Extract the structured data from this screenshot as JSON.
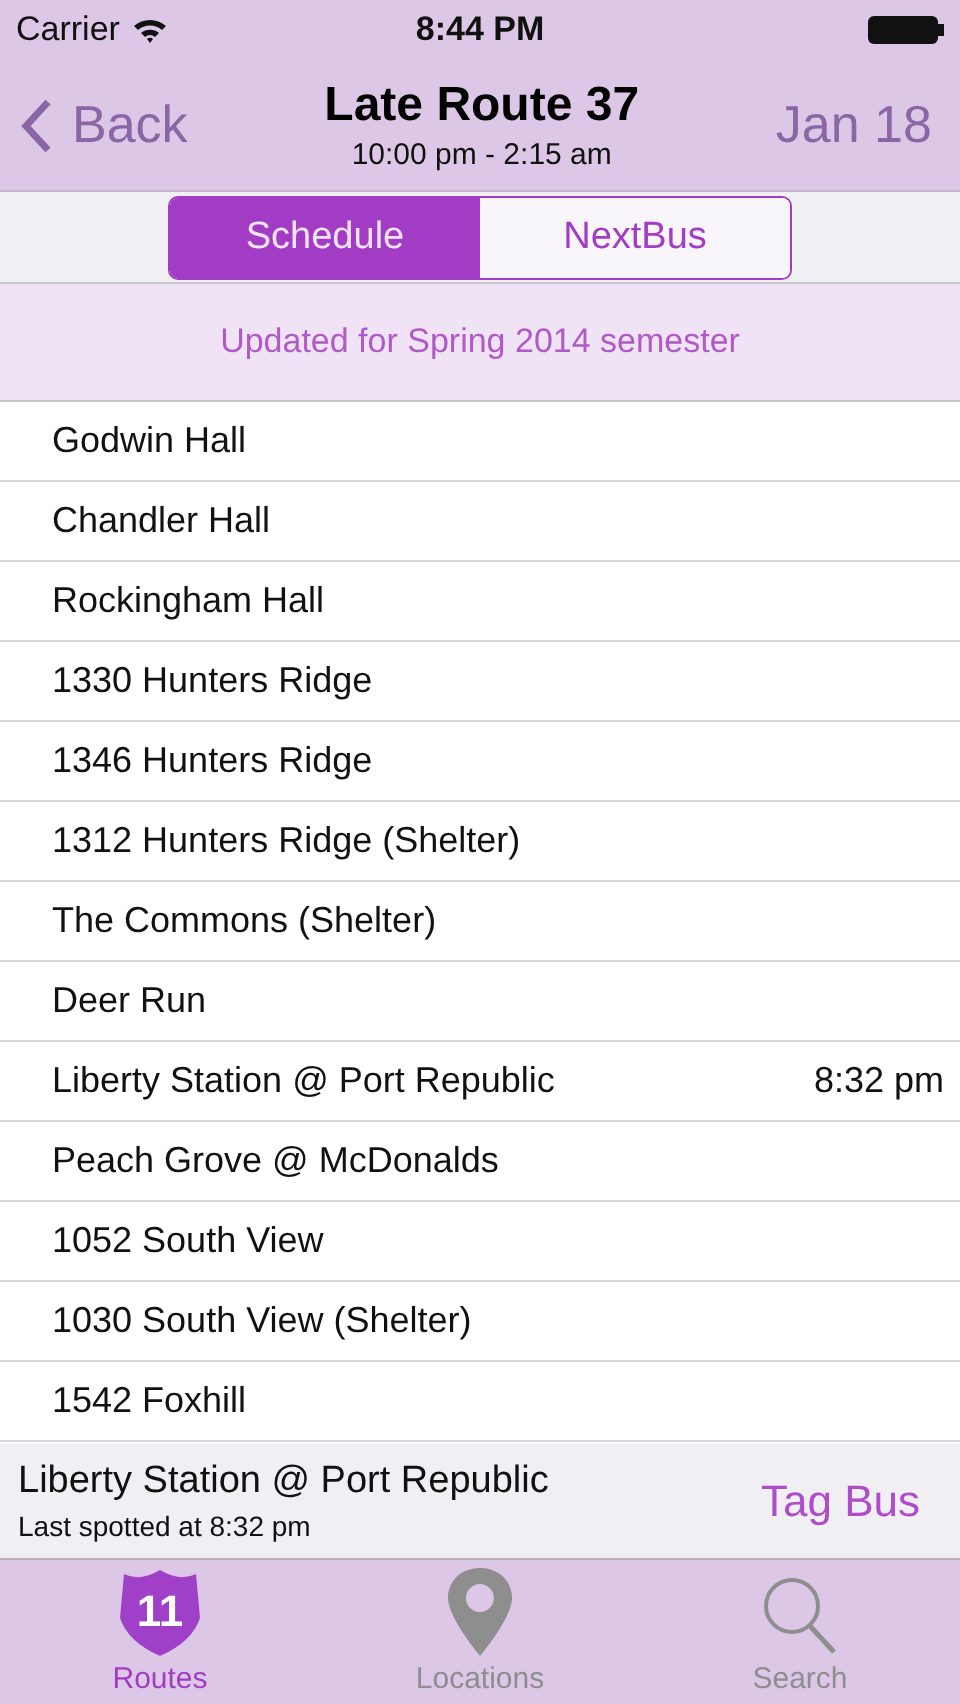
{
  "status_bar": {
    "carrier": "Carrier",
    "time": "8:44 PM"
  },
  "nav": {
    "back": "Back",
    "title": "Late Route 37",
    "subtitle": "10:00 pm - 2:15 am",
    "date": "Jan 18"
  },
  "segments": [
    {
      "label": "Schedule",
      "selected": true
    },
    {
      "label": "NextBus",
      "selected": false
    }
  ],
  "notice": "Updated for Spring 2014 semester",
  "stops": [
    {
      "name": "Godwin Hall"
    },
    {
      "name": "Chandler Hall"
    },
    {
      "name": "Rockingham Hall"
    },
    {
      "name": "1330 Hunters Ridge"
    },
    {
      "name": "1346 Hunters Ridge"
    },
    {
      "name": "1312 Hunters Ridge (Shelter)"
    },
    {
      "name": "The Commons (Shelter)"
    },
    {
      "name": "Deer Run"
    },
    {
      "name": "Liberty Station @ Port Republic",
      "time": "8:32 pm"
    },
    {
      "name": "Peach Grove @ McDonalds"
    },
    {
      "name": "1052 South View"
    },
    {
      "name": "1030 South View (Shelter)"
    },
    {
      "name": "1542 Foxhill"
    }
  ],
  "last_seen": {
    "stop": "Liberty Station @ Port Republic",
    "note": "Last spotted at 8:32 pm",
    "action": "Tag Bus"
  },
  "tab_bar": [
    {
      "kind": "routes",
      "label": "Routes",
      "badge": "11",
      "selected": true
    },
    {
      "kind": "locations",
      "label": "Locations",
      "selected": false
    },
    {
      "kind": "search",
      "label": "Search",
      "selected": false
    }
  ]
}
